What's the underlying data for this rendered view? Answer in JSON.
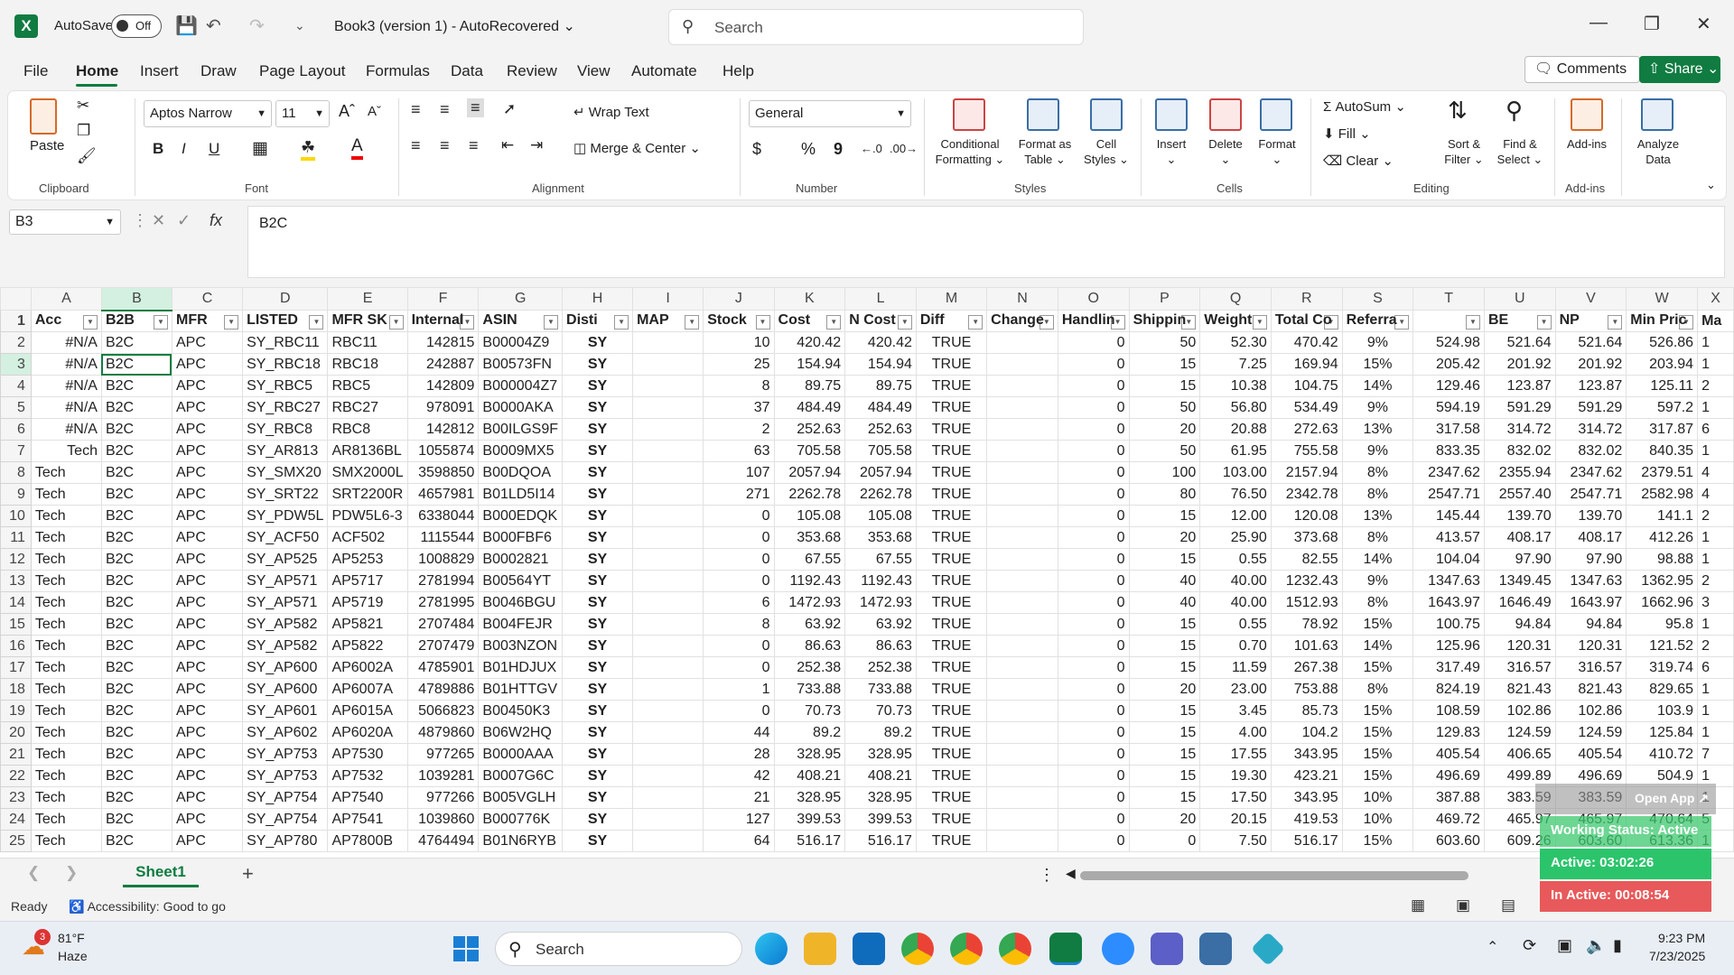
{
  "titlebar": {
    "autosave_label": "AutoSave",
    "toggle_state": "Off",
    "document_title": "Book3 (version 1)  -  AutoRecovered",
    "search_placeholder": "Search"
  },
  "menu": [
    "File",
    "Home",
    "Insert",
    "Draw",
    "Page Layout",
    "Formulas",
    "Data",
    "Review",
    "View",
    "Automate",
    "Help"
  ],
  "menu_right": {
    "comments": "Comments",
    "share": "Share"
  },
  "ribbon": {
    "clipboard": {
      "paste": "Paste",
      "label": "Clipboard"
    },
    "font": {
      "name": "Aptos Narrow",
      "size": "11",
      "label": "Font",
      "bold": "B",
      "italic": "I",
      "underline": "U"
    },
    "alignment": {
      "wrap": "Wrap Text",
      "merge": "Merge & Center",
      "label": "Alignment"
    },
    "number": {
      "format": "General",
      "currency": "$",
      "percent": "%",
      "comma": "9",
      "label": "Number"
    },
    "styles": {
      "conditional": "Conditional",
      "conditional2": "Formatting",
      "format_table": "Format as",
      "format_table2": "Table",
      "cell_styles": "Cell",
      "cell_styles2": "Styles",
      "label": "Styles"
    },
    "cells": {
      "insert": "Insert",
      "delete": "Delete",
      "format": "Format",
      "label": "Cells"
    },
    "editing": {
      "autosum": "AutoSum",
      "fill": "Fill",
      "clear": "Clear",
      "sort": "Sort &",
      "sort2": "Filter",
      "find": "Find &",
      "find2": "Select",
      "label": "Editing"
    },
    "addins": {
      "addins": "Add-ins",
      "label": "Add-ins"
    },
    "analyze": {
      "line1": "Analyze",
      "line2": "Data"
    }
  },
  "formula_bar": {
    "name_box": "B3",
    "fx": "fx",
    "content": "B2C"
  },
  "columns": [
    "A",
    "B",
    "C",
    "D",
    "E",
    "F",
    "G",
    "H",
    "I",
    "J",
    "K",
    "L",
    "M",
    "N",
    "O",
    "P",
    "Q",
    "R",
    "S",
    "T",
    "U",
    "V",
    "W",
    "X"
  ],
  "header_row": {
    "num": "1",
    "cells": [
      "Acc",
      "B2B",
      "MFR",
      "LISTED",
      "MFR SK",
      "Internal",
      "ASIN",
      "Disti",
      "MAP",
      "Stock",
      "Cost",
      "N Cost",
      "Diff",
      "Change",
      "Handlin",
      "Shippin",
      "Weight",
      "Total Co",
      "Referra",
      "",
      "BE",
      "NP",
      "Min Pric",
      "Ma"
    ]
  },
  "rows": [
    {
      "num": "2",
      "cells": [
        "#N/A",
        "B2C",
        "APC",
        "SY_RBC11",
        "RBC11",
        "142815",
        "B00004Z9",
        "SY",
        "",
        "10",
        "420.42",
        "420.42",
        "TRUE",
        "",
        "0",
        "50",
        "52.30",
        "470.42",
        "9%",
        "524.98",
        "521.64",
        "521.64",
        "526.86",
        "1"
      ]
    },
    {
      "num": "3",
      "cells": [
        "#N/A",
        "B2C",
        "APC",
        "SY_RBC18",
        "RBC18",
        "242887",
        "B00573FN",
        "SY",
        "",
        "25",
        "154.94",
        "154.94",
        "TRUE",
        "",
        "0",
        "15",
        "7.25",
        "169.94",
        "15%",
        "205.42",
        "201.92",
        "201.92",
        "203.94",
        "1"
      ]
    },
    {
      "num": "4",
      "cells": [
        "#N/A",
        "B2C",
        "APC",
        "SY_RBC5",
        "RBC5",
        "142809",
        "B000004Z7",
        "SY",
        "",
        "8",
        "89.75",
        "89.75",
        "TRUE",
        "",
        "0",
        "15",
        "10.38",
        "104.75",
        "14%",
        "129.46",
        "123.87",
        "123.87",
        "125.11",
        "2"
      ]
    },
    {
      "num": "5",
      "cells": [
        "#N/A",
        "B2C",
        "APC",
        "SY_RBC27",
        "RBC27",
        "978091",
        "B0000AKA",
        "SY",
        "",
        "37",
        "484.49",
        "484.49",
        "TRUE",
        "",
        "0",
        "50",
        "56.80",
        "534.49",
        "9%",
        "594.19",
        "591.29",
        "591.29",
        "597.2",
        "1"
      ]
    },
    {
      "num": "6",
      "cells": [
        "#N/A",
        "B2C",
        "APC",
        "SY_RBC8",
        "RBC8",
        "142812",
        "B00ILGS9F",
        "SY",
        "",
        "2",
        "252.63",
        "252.63",
        "TRUE",
        "",
        "0",
        "20",
        "20.88",
        "272.63",
        "13%",
        "317.58",
        "314.72",
        "314.72",
        "317.87",
        "6"
      ]
    },
    {
      "num": "7",
      "cells": [
        "Tech",
        "B2C",
        "APC",
        "SY_AR813",
        "AR8136BL",
        "1055874",
        "B0009MX5",
        "SY",
        "",
        "63",
        "705.58",
        "705.58",
        "TRUE",
        "",
        "0",
        "50",
        "61.95",
        "755.58",
        "9%",
        "833.35",
        "832.02",
        "832.02",
        "840.35",
        "1"
      ]
    },
    {
      "num": "8",
      "cells": [
        "Tech",
        "B2C",
        "APC",
        "SY_SMX20",
        "SMX2000L",
        "3598850",
        "B00DQOA",
        "SY",
        "",
        "107",
        "2057.94",
        "2057.94",
        "TRUE",
        "",
        "0",
        "100",
        "103.00",
        "2157.94",
        "8%",
        "2347.62",
        "2355.94",
        "2347.62",
        "2379.51",
        "4"
      ]
    },
    {
      "num": "9",
      "cells": [
        "Tech",
        "B2C",
        "APC",
        "SY_SRT22",
        "SRT2200R",
        "4657981",
        "B01LD5I14",
        "SY",
        "",
        "271",
        "2262.78",
        "2262.78",
        "TRUE",
        "",
        "0",
        "80",
        "76.50",
        "2342.78",
        "8%",
        "2547.71",
        "2557.40",
        "2547.71",
        "2582.98",
        "4"
      ]
    },
    {
      "num": "10",
      "cells": [
        "Tech",
        "B2C",
        "APC",
        "SY_PDW5L",
        "PDW5L6-3",
        "6338044",
        "B000EDQK",
        "SY",
        "",
        "0",
        "105.08",
        "105.08",
        "TRUE",
        "",
        "0",
        "15",
        "12.00",
        "120.08",
        "13%",
        "145.44",
        "139.70",
        "139.70",
        "141.1",
        "2"
      ]
    },
    {
      "num": "11",
      "cells": [
        "Tech",
        "B2C",
        "APC",
        "SY_ACF50",
        "ACF502",
        "1115544",
        "B000FBF6",
        "SY",
        "",
        "0",
        "353.68",
        "353.68",
        "TRUE",
        "",
        "0",
        "20",
        "25.90",
        "373.68",
        "8%",
        "413.57",
        "408.17",
        "408.17",
        "412.26",
        "1"
      ]
    },
    {
      "num": "12",
      "cells": [
        "Tech",
        "B2C",
        "APC",
        "SY_AP525",
        "AP5253",
        "1008829",
        "B0002821",
        "SY",
        "",
        "0",
        "67.55",
        "67.55",
        "TRUE",
        "",
        "0",
        "15",
        "0.55",
        "82.55",
        "14%",
        "104.04",
        "97.90",
        "97.90",
        "98.88",
        "1"
      ]
    },
    {
      "num": "13",
      "cells": [
        "Tech",
        "B2C",
        "APC",
        "SY_AP571",
        "AP5717",
        "2781994",
        "B00564YT",
        "SY",
        "",
        "0",
        "1192.43",
        "1192.43",
        "TRUE",
        "",
        "0",
        "40",
        "40.00",
        "1232.43",
        "9%",
        "1347.63",
        "1349.45",
        "1347.63",
        "1362.95",
        "2"
      ]
    },
    {
      "num": "14",
      "cells": [
        "Tech",
        "B2C",
        "APC",
        "SY_AP571",
        "AP5719",
        "2781995",
        "B0046BGU",
        "SY",
        "",
        "6",
        "1472.93",
        "1472.93",
        "TRUE",
        "",
        "0",
        "40",
        "40.00",
        "1512.93",
        "8%",
        "1643.97",
        "1646.49",
        "1643.97",
        "1662.96",
        "3"
      ]
    },
    {
      "num": "15",
      "cells": [
        "Tech",
        "B2C",
        "APC",
        "SY_AP582",
        "AP5821",
        "2707484",
        "B004FEJR",
        "SY",
        "",
        "8",
        "63.92",
        "63.92",
        "TRUE",
        "",
        "0",
        "15",
        "0.55",
        "78.92",
        "15%",
        "100.75",
        "94.84",
        "94.84",
        "95.8",
        "1"
      ]
    },
    {
      "num": "16",
      "cells": [
        "Tech",
        "B2C",
        "APC",
        "SY_AP582",
        "AP5822",
        "2707479",
        "B003NZON",
        "SY",
        "",
        "0",
        "86.63",
        "86.63",
        "TRUE",
        "",
        "0",
        "15",
        "0.70",
        "101.63",
        "14%",
        "125.96",
        "120.31",
        "120.31",
        "121.52",
        "2"
      ]
    },
    {
      "num": "17",
      "cells": [
        "Tech",
        "B2C",
        "APC",
        "SY_AP600",
        "AP6002A",
        "4785901",
        "B01HDJUX",
        "SY",
        "",
        "0",
        "252.38",
        "252.38",
        "TRUE",
        "",
        "0",
        "15",
        "11.59",
        "267.38",
        "15%",
        "317.49",
        "316.57",
        "316.57",
        "319.74",
        "6"
      ]
    },
    {
      "num": "18",
      "cells": [
        "Tech",
        "B2C",
        "APC",
        "SY_AP600",
        "AP6007A",
        "4789886",
        "B01HTTGV",
        "SY",
        "",
        "1",
        "733.88",
        "733.88",
        "TRUE",
        "",
        "0",
        "20",
        "23.00",
        "753.88",
        "8%",
        "824.19",
        "821.43",
        "821.43",
        "829.65",
        "1"
      ]
    },
    {
      "num": "19",
      "cells": [
        "Tech",
        "B2C",
        "APC",
        "SY_AP601",
        "AP6015A",
        "5066823",
        "B00450K3",
        "SY",
        "",
        "0",
        "70.73",
        "70.73",
        "TRUE",
        "",
        "0",
        "15",
        "3.45",
        "85.73",
        "15%",
        "108.59",
        "102.86",
        "102.86",
        "103.9",
        "1"
      ]
    },
    {
      "num": "20",
      "cells": [
        "Tech",
        "B2C",
        "APC",
        "SY_AP602",
        "AP6020A",
        "4879860",
        "B06W2HQ",
        "SY",
        "",
        "44",
        "89.2",
        "89.2",
        "TRUE",
        "",
        "0",
        "15",
        "4.00",
        "104.2",
        "15%",
        "129.83",
        "124.59",
        "124.59",
        "125.84",
        "1"
      ]
    },
    {
      "num": "21",
      "cells": [
        "Tech",
        "B2C",
        "APC",
        "SY_AP753",
        "AP7530",
        "977265",
        "B0000AAA",
        "SY",
        "",
        "28",
        "328.95",
        "328.95",
        "TRUE",
        "",
        "0",
        "15",
        "17.55",
        "343.95",
        "15%",
        "405.54",
        "406.65",
        "405.54",
        "410.72",
        "7"
      ]
    },
    {
      "num": "22",
      "cells": [
        "Tech",
        "B2C",
        "APC",
        "SY_AP753",
        "AP7532",
        "1039281",
        "B0007G6C",
        "SY",
        "",
        "42",
        "408.21",
        "408.21",
        "TRUE",
        "",
        "0",
        "15",
        "19.30",
        "423.21",
        "15%",
        "496.69",
        "499.89",
        "496.69",
        "504.9",
        "1"
      ]
    },
    {
      "num": "23",
      "cells": [
        "Tech",
        "B2C",
        "APC",
        "SY_AP754",
        "AP7540",
        "977266",
        "B005VGLH",
        "SY",
        "",
        "21",
        "328.95",
        "328.95",
        "TRUE",
        "",
        "0",
        "15",
        "17.50",
        "343.95",
        "10%",
        "387.88",
        "383.59",
        "383.59",
        "",
        "1"
      ]
    },
    {
      "num": "24",
      "cells": [
        "Tech",
        "B2C",
        "APC",
        "SY_AP754",
        "AP7541",
        "1039860",
        "B000776K",
        "SY",
        "",
        "127",
        "399.53",
        "399.53",
        "TRUE",
        "",
        "0",
        "20",
        "20.15",
        "419.53",
        "10%",
        "469.72",
        "465.97",
        "465.97",
        "470.64",
        "5"
      ]
    },
    {
      "num": "25",
      "cells": [
        "Tech",
        "B2C",
        "APC",
        "SY_AP780",
        "AP7800B",
        "4764494",
        "B01N6RYB",
        "SY",
        "",
        "64",
        "516.17",
        "516.17",
        "TRUE",
        "",
        "0",
        "0",
        "7.50",
        "516.17",
        "15%",
        "603.60",
        "609.26",
        "603.60",
        "613.36",
        "1"
      ]
    }
  ],
  "sheet_tabs": {
    "active": "Sheet1",
    "add": "+"
  },
  "status": {
    "ready": "Ready",
    "accessibility": "Accessibility: Good to go"
  },
  "taskbar": {
    "temp": "81°F",
    "weather": "Haze",
    "weather_badge": "3",
    "search": "Search",
    "time": "9:23 PM",
    "date": "7/23/2025"
  },
  "widget": {
    "open_app": "Open App ↗",
    "working": "Working Status: Active",
    "active": "Active: 03:02:26",
    "inactive": "In Active: 00:08:54"
  },
  "colors": {
    "excel_green": "#107c41",
    "widget_green": "#2bc46b",
    "widget_red": "#e8595b"
  }
}
